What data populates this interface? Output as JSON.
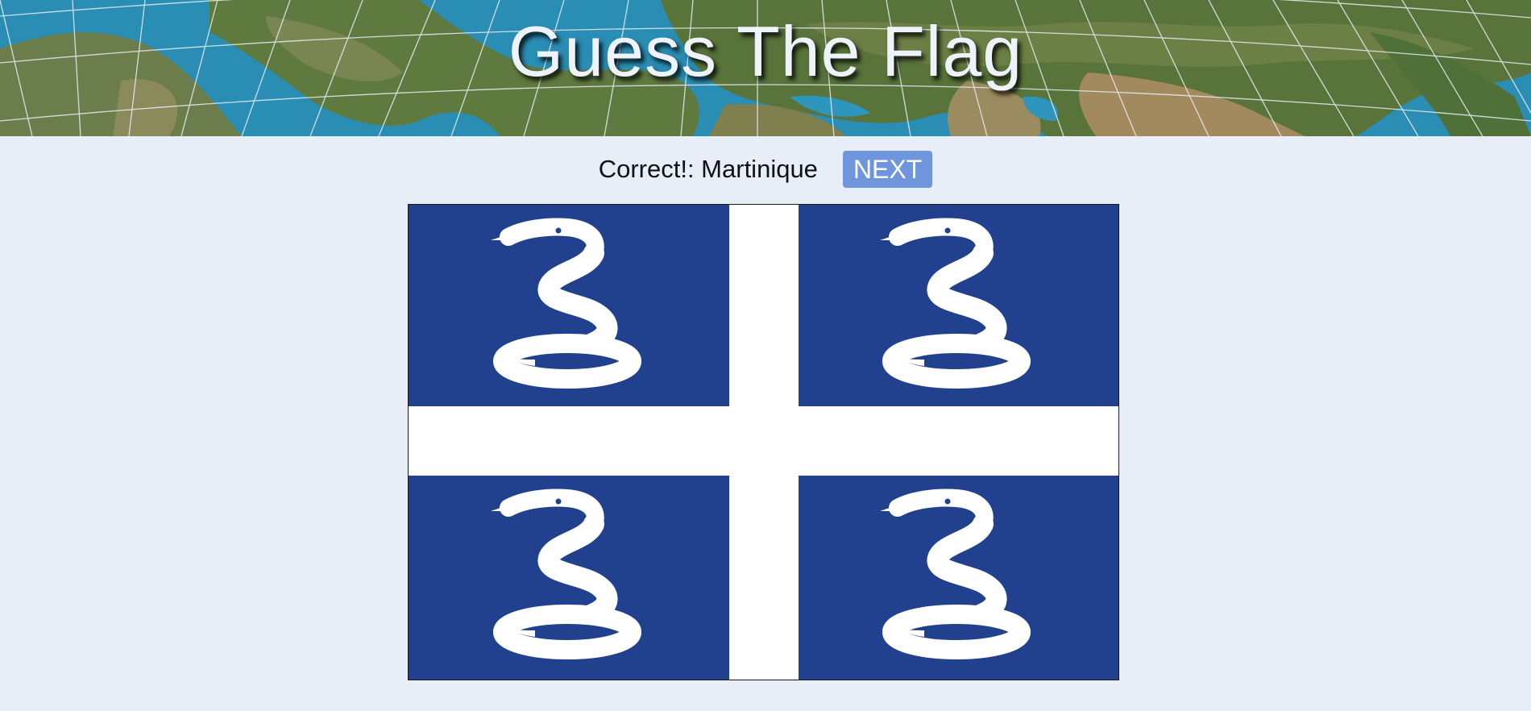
{
  "header": {
    "title": "Guess The Flag",
    "background": "world-map-satellite"
  },
  "status": {
    "result_text": "Correct!: Martinique",
    "next_label": "NEXT"
  },
  "flag": {
    "country": "Martinique",
    "field_color": "#21418f",
    "cross_color": "#ffffff",
    "emblem": "snake-icon"
  },
  "colors": {
    "page_background": "#e8eef8",
    "button_background": "#6f95dc",
    "title_text": "#eef2fb"
  }
}
